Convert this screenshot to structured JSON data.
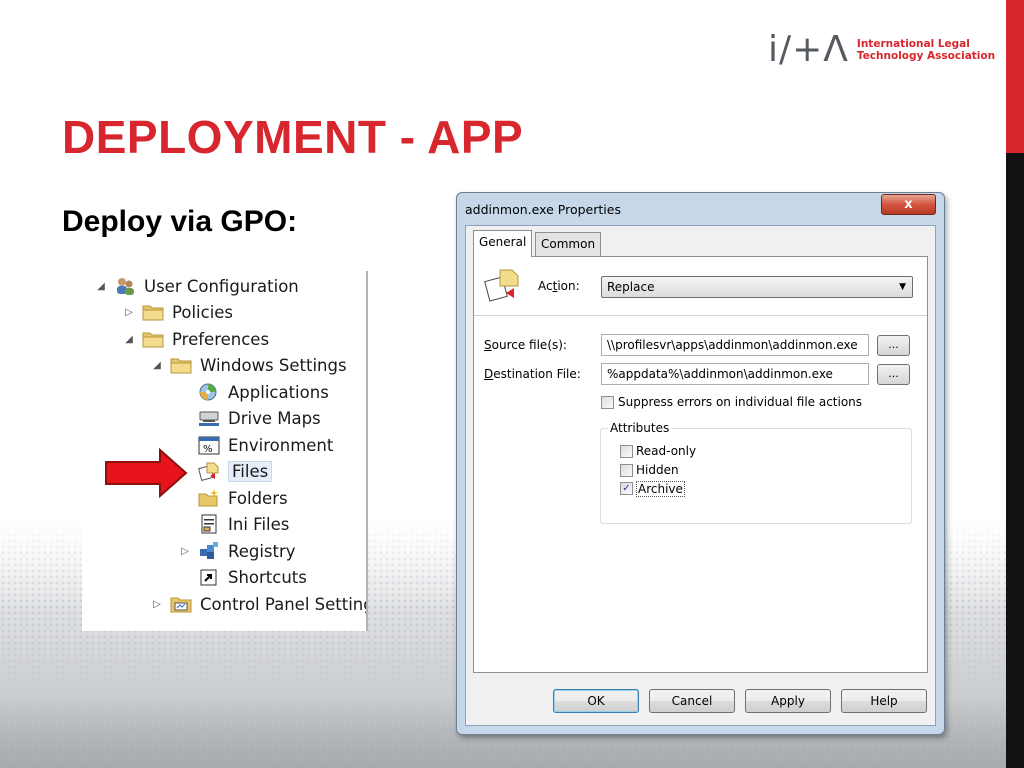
{
  "slide": {
    "title": "DEPLOYMENT - APP",
    "subtitle": "Deploy via GPO:",
    "colors": {
      "accent_red": "#d7262d",
      "edge_black": "#111111"
    }
  },
  "logo": {
    "mark": "i/+Λ",
    "line1": "International Legal",
    "line2": "Technology Association"
  },
  "tree": {
    "items": [
      {
        "label": "User Configuration",
        "icon": "users-icon",
        "expander": "expanded"
      },
      {
        "label": "Policies",
        "icon": "folder-icon",
        "expander": "collapsed"
      },
      {
        "label": "Preferences",
        "icon": "folder-icon",
        "expander": "expanded"
      },
      {
        "label": "Windows Settings",
        "icon": "folder-icon",
        "expander": "expanded"
      },
      {
        "label": "Applications",
        "icon": "applications-icon",
        "expander": "none"
      },
      {
        "label": "Drive Maps",
        "icon": "drive-icon",
        "expander": "none"
      },
      {
        "label": "Environment",
        "icon": "environment-icon",
        "expander": "none"
      },
      {
        "label": "Files",
        "icon": "files-icon",
        "expander": "none",
        "selected": true
      },
      {
        "label": "Folders",
        "icon": "folder-new-icon",
        "expander": "none"
      },
      {
        "label": "Ini Files",
        "icon": "ini-file-icon",
        "expander": "none"
      },
      {
        "label": "Registry",
        "icon": "registry-icon",
        "expander": "collapsed"
      },
      {
        "label": "Shortcuts",
        "icon": "shortcut-icon",
        "expander": "none"
      },
      {
        "label": "Control Panel Setting",
        "icon": "control-panel-icon",
        "expander": "collapsed"
      }
    ]
  },
  "dialog": {
    "title": "addinmon.exe Properties",
    "close_label": "x",
    "tabs": [
      "General",
      "Common"
    ],
    "action_label": "Action:",
    "action_value": "Replace",
    "source_label": "Source file(s):",
    "source_value": "\\\\profilesvr\\apps\\addinmon\\addinmon.exe",
    "dest_label": "Destination File:",
    "dest_value": "%appdata%\\addinmon\\addinmon.exe",
    "browse_label": "...",
    "suppress_label": "Suppress errors on individual file actions",
    "suppress_checked": false,
    "attributes_title": "Attributes",
    "attributes": [
      {
        "label": "Read-only",
        "checked": false
      },
      {
        "label": "Hidden",
        "checked": false
      },
      {
        "label": "Archive",
        "checked": true
      }
    ],
    "buttons": {
      "ok": "OK",
      "cancel": "Cancel",
      "apply": "Apply",
      "help": "Help"
    }
  }
}
